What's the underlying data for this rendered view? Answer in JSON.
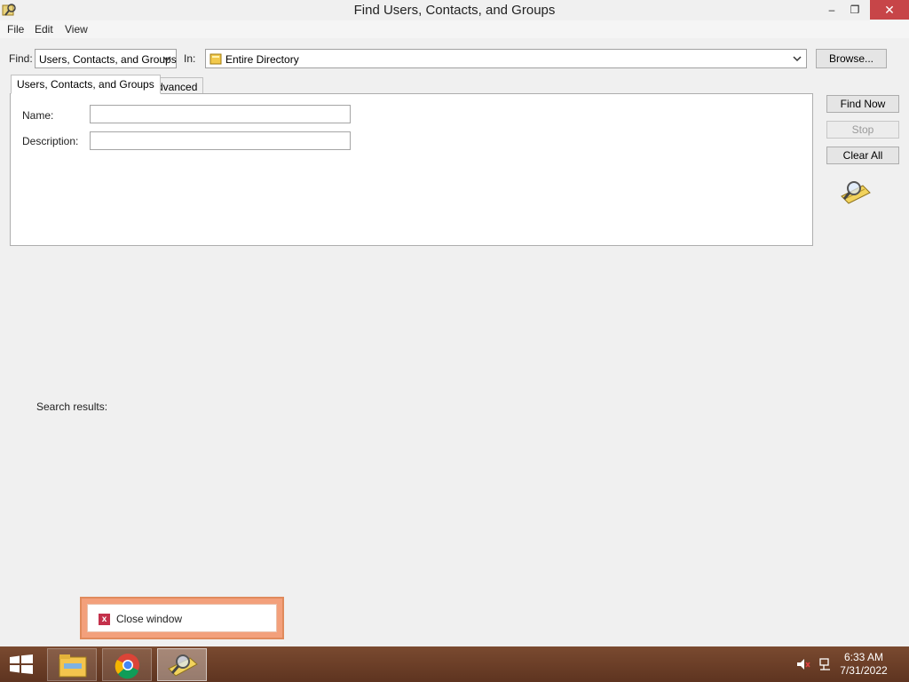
{
  "window": {
    "title": "Find Users, Contacts, and Groups",
    "buttons": {
      "minimize": "–",
      "maximize": "❐",
      "close": "✕"
    }
  },
  "menu": {
    "file": "File",
    "edit": "Edit",
    "view": "View"
  },
  "find_row": {
    "find_label": "Find:",
    "find_value": "Users, Contacts, and Groups",
    "in_label": "In:",
    "in_value": "Entire Directory",
    "browse_label": "Browse..."
  },
  "tabs": [
    {
      "label": "Users, Contacts, and Groups",
      "active": true
    },
    {
      "label": "Advanced",
      "active": false
    }
  ],
  "form": {
    "name_label": "Name:",
    "name_value": "",
    "description_label": "Description:",
    "description_value": ""
  },
  "actions": {
    "find_now": "Find Now",
    "stop": "Stop",
    "clear_all": "Clear All"
  },
  "results": {
    "label": "Search results:"
  },
  "toast": {
    "text": "Close window",
    "icon": "x-icon"
  },
  "taskbar": {
    "apps": [
      "file-explorer-icon",
      "chrome-icon",
      "find-users-icon"
    ],
    "active_app": "find-users-icon",
    "clock_time": "6:33 AM",
    "clock_date": "7/31/2022"
  },
  "colors": {
    "close_button": "#c74548",
    "toast_border": "#f3a07b",
    "taskbar": "#6b3d27"
  }
}
